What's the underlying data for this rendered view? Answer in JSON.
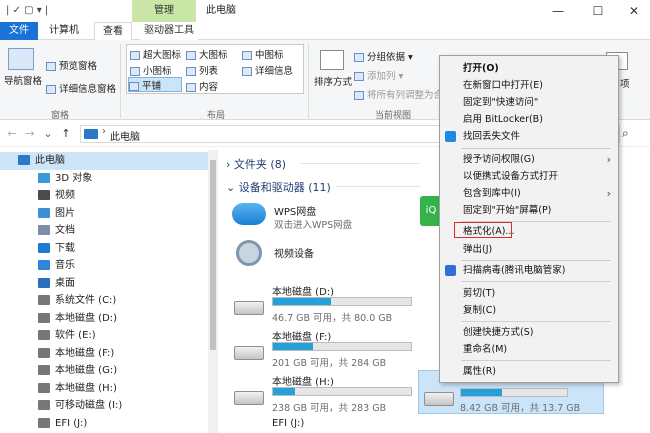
{
  "window": {
    "title": "此电脑",
    "manage_tab": "管理",
    "minimize": "—",
    "maximize": "☐",
    "close": "✕",
    "quick_access": "| ✓ ▢ ▾ |"
  },
  "ribbon_tabs": {
    "file": "文件",
    "computer": "计算机",
    "view": "查看",
    "drive_tools": "驱动器工具"
  },
  "ribbon": {
    "nav_pane": "导航窗格",
    "preview_pane": "预览窗格",
    "details_pane": "详细信息窗格",
    "group_panes": "窗格",
    "layout": {
      "xl_icons": "超大图标",
      "large_icons": "大图标",
      "medium_icons": "中图标",
      "small_icons": "小图标",
      "list": "列表",
      "details": "详细信息",
      "tiles": "平铺",
      "content": "内容"
    },
    "group_layout": "布局",
    "sort_by": "排序方式",
    "group_by": "分组依据",
    "add_column": "添加列",
    "fit_columns": "将所有列调整为合",
    "group_current_view": "当前视图",
    "item_checkbox": "项目复选框",
    "options_short": "项"
  },
  "address": {
    "back": "←",
    "forward": "→",
    "down": "⌄",
    "up": "↑",
    "path": "此电脑",
    "search_icon_glyph": "⌕"
  },
  "nav_items": [
    {
      "label": "此电脑",
      "color": "#2b78c8"
    },
    {
      "label": "3D 对象",
      "color": "#3a9ad9"
    },
    {
      "label": "视频",
      "color": "#4b4b4b"
    },
    {
      "label": "图片",
      "color": "#3d8fd6"
    },
    {
      "label": "文档",
      "color": "#7a8fa6"
    },
    {
      "label": "下载",
      "color": "#1e7ad6"
    },
    {
      "label": "音乐",
      "color": "#2f86d8"
    },
    {
      "label": "桌面",
      "color": "#2c6fbf"
    },
    {
      "label": "系统文件 (C:)",
      "color": "#777"
    },
    {
      "label": "本地磁盘 (D:)",
      "color": "#777"
    },
    {
      "label": "软件 (E:)",
      "color": "#777"
    },
    {
      "label": "本地磁盘 (F:)",
      "color": "#777"
    },
    {
      "label": "本地磁盘 (G:)",
      "color": "#777"
    },
    {
      "label": "本地磁盘 (H:)",
      "color": "#777"
    },
    {
      "label": "可移动磁盘 (I:)",
      "color": "#777"
    },
    {
      "label": "EFI (J:)",
      "color": "#777"
    }
  ],
  "content": {
    "folders_header": "文件夹 (8)",
    "devices_header": "设备和驱动器 (11)",
    "wps_title": "WPS网盘",
    "wps_sub": "双击进入WPS网盘",
    "video_device": "视频设备",
    "drives": [
      {
        "label": "本地磁盘 (D:)",
        "sub": "46.7 GB 可用，共 80.0 GB",
        "used": 0.42
      },
      {
        "label": "本地磁盘 (F:)",
        "sub": "201 GB 可用，共 284 GB",
        "used": 0.29
      },
      {
        "label": "本地磁盘 (H:)",
        "sub": "238 GB 可用，共 283 GB",
        "used": 0.16
      },
      {
        "label": "EFI (J:)",
        "sub": "",
        "used": 0
      }
    ],
    "selected_drive_sub": "8.42 GB 可用，共 13.7 GB",
    "selected_drive_used": 0.39
  },
  "context_menu": {
    "open": "打开(O)",
    "open_new": "在新窗口中打开(E)",
    "pin_quick": "固定到\"快速访问\"",
    "bitlocker": "启用 BitLocker(B)",
    "find_lost": "找回丢失文件",
    "grant_access": "授予访问权限(G)",
    "portable": "以便携式设备方式打开",
    "include_library": "包含到库中(I)",
    "pin_start": "固定到\"开始\"屏幕(P)",
    "format": "格式化(A)...",
    "eject": "弹出(J)",
    "scan_virus": "扫描病毒(腾讯电脑管家)",
    "cut": "剪切(T)",
    "copy": "复制(C)",
    "create_shortcut": "创建快捷方式(S)",
    "rename": "重命名(M)",
    "properties": "属性(R)"
  },
  "colors": {
    "accent": "#1a73d4",
    "manage_tab": "#c9e6a6",
    "bar_fill": "#26a0da",
    "format_highlight": "#d13030"
  }
}
